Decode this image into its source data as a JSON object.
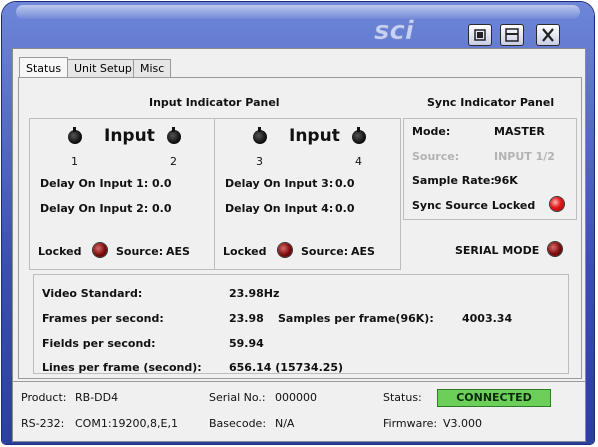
{
  "titlebar": {
    "logo_text": "sci"
  },
  "tabs": [
    "Status",
    "Unit Setup",
    "Misc"
  ],
  "input_panel": {
    "title": "Input Indicator Panel",
    "left": {
      "heading": "Input",
      "num_a": "1",
      "num_b": "2",
      "delay_a_label": "Delay On Input 1:",
      "delay_a_value": "0.0",
      "delay_b_label": "Delay On Input 2:",
      "delay_b_value": "0.0",
      "locked_label": "Locked",
      "source_label": "Source:",
      "source_value": "AES"
    },
    "right": {
      "heading": "Input",
      "num_a": "3",
      "num_b": "4",
      "delay_a_label": "Delay On Input 3:",
      "delay_a_value": "0.0",
      "delay_b_label": "Delay On Input 4:",
      "delay_b_value": "0.0",
      "locked_label": "Locked",
      "source_label": "Source:",
      "source_value": "AES"
    }
  },
  "sync_panel": {
    "title": "Sync Indicator Panel",
    "mode_label": "Mode:",
    "mode_value": "MASTER",
    "source_label": "Source:",
    "source_value": "INPUT 1/2",
    "rate_label": "Sample Rate:",
    "rate_value": "96K",
    "locked_label": "Sync Source Locked",
    "serial_mode_label": "SERIAL MODE"
  },
  "video": {
    "standard_label": "Video Standard:",
    "standard_value": "23.98Hz",
    "fps_label": "Frames per second:",
    "fps_value": "23.98",
    "spf_label": "Samples per frame(96K):",
    "spf_value": "4003.34",
    "fields_label": "Fields per second:",
    "fields_value": "59.94",
    "lines_label": "Lines per frame (second):",
    "lines_value": "656.14 (15734.25)"
  },
  "footer": {
    "product_label": "Product:",
    "product_value": "RB-DD4",
    "serial_label": "Serial No.:",
    "serial_value": "000000",
    "status_label": "Status:",
    "status_value": "CONNECTED",
    "rs232_label": "RS-232:",
    "rs232_value": "COM1:19200,8,E,1",
    "basecode_label": "Basecode:",
    "basecode_value": "N/A",
    "firmware_label": "Firmware:",
    "firmware_value": "V3.000"
  },
  "colors": {
    "status_ok": "#6bcf5a",
    "led_on": "#e01818",
    "led_off": "#7a0b0b",
    "titlebar": "#3a4fb0"
  },
  "icons": {
    "minimize": "minimize-icon",
    "maximize": "maximize-icon",
    "close": "close-icon"
  }
}
